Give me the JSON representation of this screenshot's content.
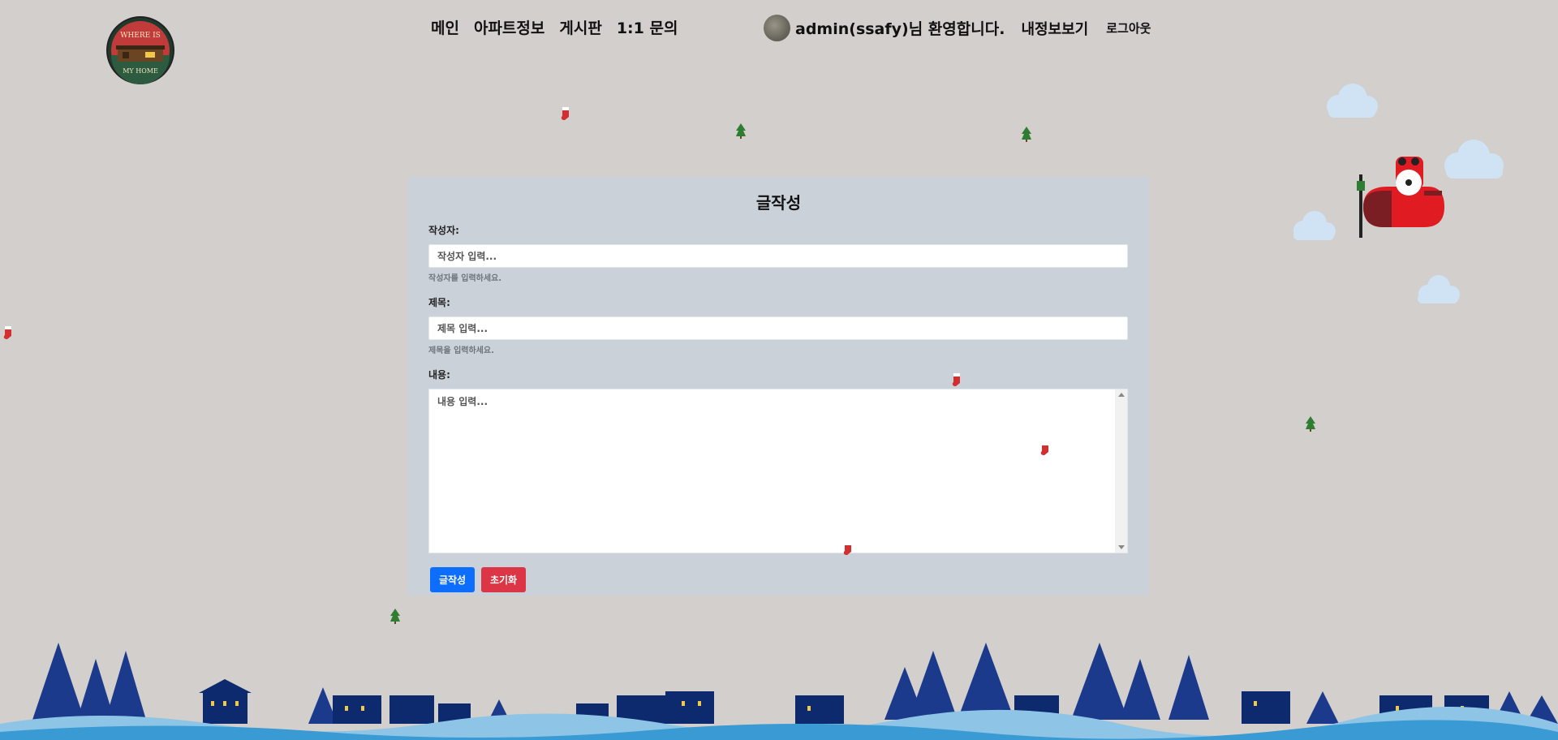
{
  "logo": {
    "text_top": "WHERE IS",
    "text_bottom": "MY HOME"
  },
  "nav": {
    "items": [
      {
        "label": "메인"
      },
      {
        "label": "아파트정보"
      },
      {
        "label": "게시판"
      },
      {
        "label": "1:1 문의"
      }
    ]
  },
  "user": {
    "welcome": "admin(ssafy)님 환영합니다.",
    "mypage": "내정보보기",
    "logout": "로그아웃"
  },
  "form": {
    "title": "글작성",
    "author_label": "작성자:",
    "author_placeholder": "작성자 입력...",
    "author_help": "작성자를 입력하세요.",
    "title_label": "제목:",
    "title_placeholder": "제목 입력...",
    "title_help": "제목을 입력하세요.",
    "content_label": "내용:",
    "content_placeholder": "내용 입력...",
    "submit_label": "글작성",
    "reset_label": "초기화"
  },
  "colors": {
    "background": "#d3cfcc",
    "card": "#cbd1d9",
    "submit": "#0d6efd",
    "reset": "#dc3545"
  },
  "icons": [
    "stocking-icon",
    "tree-icon",
    "santa-plane-icon",
    "cloud-icon"
  ]
}
